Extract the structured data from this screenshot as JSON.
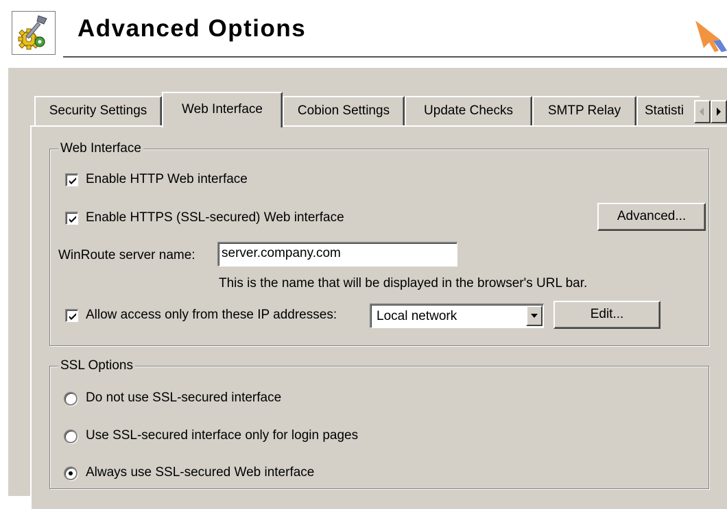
{
  "header": {
    "title": "Advanced Options",
    "icon": "gear-wrench-icon"
  },
  "tabs": [
    {
      "label": "Security Settings",
      "active": false
    },
    {
      "label": "Web Interface",
      "active": true
    },
    {
      "label": "Cobion Settings",
      "active": false
    },
    {
      "label": "Update Checks",
      "active": false
    },
    {
      "label": "SMTP Relay",
      "active": false
    },
    {
      "label": "Statisti",
      "active": false
    }
  ],
  "web_interface": {
    "legend": "Web Interface",
    "enable_http": {
      "label": "Enable HTTP Web interface",
      "checked": true
    },
    "enable_https": {
      "label": "Enable HTTPS (SSL-secured) Web interface",
      "checked": true
    },
    "advanced_button": "Advanced...",
    "server_name_label": "WinRoute server name:",
    "server_name_value": "server.company.com",
    "server_name_hint": "This is the name that will be displayed in the browser's URL bar.",
    "allow_access": {
      "label": "Allow access only from these IP addresses:",
      "checked": true
    },
    "ip_group_value": "Local network",
    "edit_button": "Edit..."
  },
  "ssl_options": {
    "legend": "SSL Options",
    "options": [
      {
        "label": "Do not use SSL-secured interface",
        "selected": false
      },
      {
        "label": "Use SSL-secured interface only for login pages",
        "selected": false
      },
      {
        "label": "Always use SSL-secured Web interface",
        "selected": true
      }
    ]
  },
  "colors": {
    "dialog_bg": "#d4d0c8",
    "arrow_orange": "#f08020",
    "arrow_blue": "#4a6fd0"
  }
}
